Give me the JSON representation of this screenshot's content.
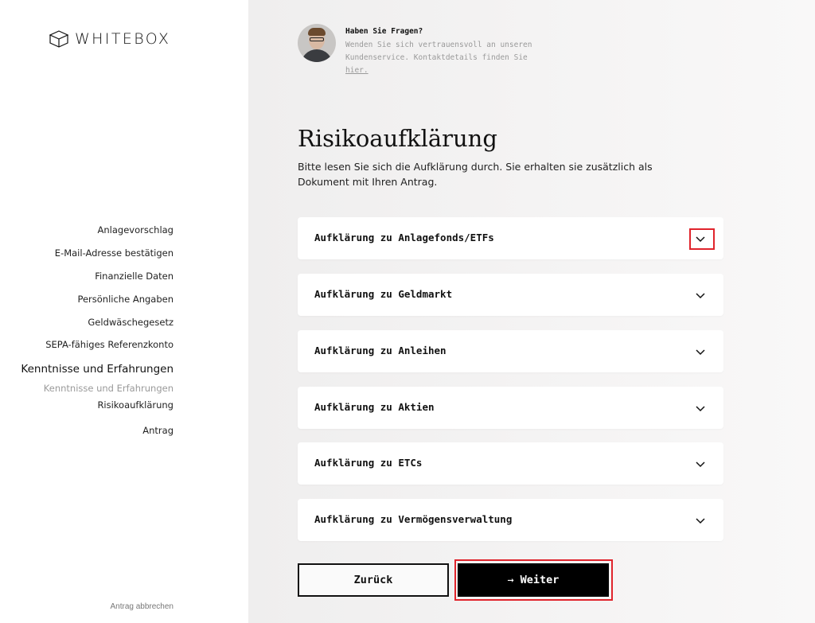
{
  "brand": {
    "name": "WHITEBOX",
    "icon": "box-outline-icon"
  },
  "sidebar": {
    "steps": [
      {
        "label": "Anlagevorschlag"
      },
      {
        "label": "E-Mail-Adresse bestätigen"
      },
      {
        "label": "Finanzielle Daten"
      },
      {
        "label": "Persönliche Angaben"
      },
      {
        "label": "Geldwäschegesetz"
      },
      {
        "label": "SEPA-fähiges Referenzkonto"
      }
    ],
    "current_section": "Kenntnisse und Erfahrungen",
    "substeps": [
      {
        "label": "Kenntnisse und Erfahrungen",
        "state": "done"
      },
      {
        "label": "Risikoaufklärung",
        "state": "active"
      }
    ],
    "final_step": "Antrag",
    "cancel_label": "Antrag abbrechen"
  },
  "help": {
    "title": "Haben Sie Fragen?",
    "body": "Wenden Sie sich vertrauensvoll an unseren Kundenservice. Kontaktdetails finden Sie",
    "link_label": "hier."
  },
  "main": {
    "title": "Risikoaufklärung",
    "description": "Bitte lesen Sie sich die Aufklärung durch. Sie erhalten sie zusätzlich als Dokument mit Ihren Antrag.",
    "accordions": [
      {
        "label": "Aufklärung zu Anlagefonds/ETFs",
        "expanded": false
      },
      {
        "label": "Aufklärung zu Geldmarkt",
        "expanded": false
      },
      {
        "label": "Aufklärung zu Anleihen",
        "expanded": false
      },
      {
        "label": "Aufklärung zu Aktien",
        "expanded": false
      },
      {
        "label": "Aufklärung zu ETCs",
        "expanded": false
      },
      {
        "label": "Aufklärung zu Vermögensverwaltung",
        "expanded": false
      }
    ]
  },
  "actions": {
    "back_label": "Zurück",
    "next_label": "Weiter",
    "next_icon": "arrow-right-icon"
  },
  "colors": {
    "highlight": "#e0242c",
    "primary_button": "#000000",
    "sidebar_bg": "#ffffff",
    "main_bg": "#f1f0f0"
  }
}
